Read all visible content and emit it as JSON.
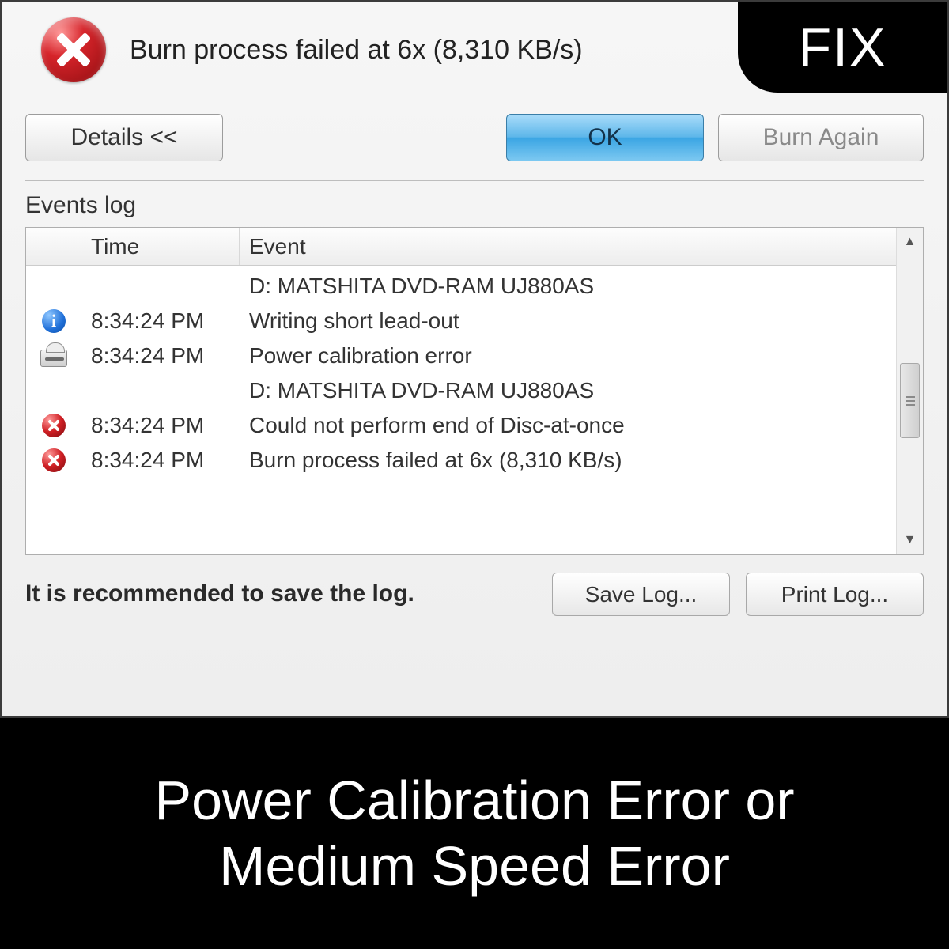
{
  "fix_badge": "FIX",
  "header_error": "Burn process failed at 6x (8,310 KB/s)",
  "buttons": {
    "details": "Details <<",
    "ok": "OK",
    "burn_again": "Burn Again",
    "save_log": "Save Log...",
    "print_log": "Print Log..."
  },
  "events_label": "Events log",
  "columns": {
    "time": "Time",
    "event": "Event"
  },
  "rows": [
    {
      "icon": "",
      "time": "",
      "event": "D: MATSHITA DVD-RAM UJ880AS"
    },
    {
      "icon": "info",
      "time": "8:34:24 PM",
      "event": "Writing short lead-out"
    },
    {
      "icon": "drive",
      "time": "8:34:24 PM",
      "event": "Power calibration error"
    },
    {
      "icon": "",
      "time": "",
      "event": "D: MATSHITA DVD-RAM UJ880AS"
    },
    {
      "icon": "err",
      "time": "8:34:24 PM",
      "event": "Could not perform end of Disc-at-once"
    },
    {
      "icon": "err",
      "time": "8:34:24 PM",
      "event": "Burn process failed at 6x (8,310 KB/s)"
    }
  ],
  "recommend_text": "It is recommended to save the log.",
  "caption": "Power Calibration Error or\nMedium Speed Error"
}
